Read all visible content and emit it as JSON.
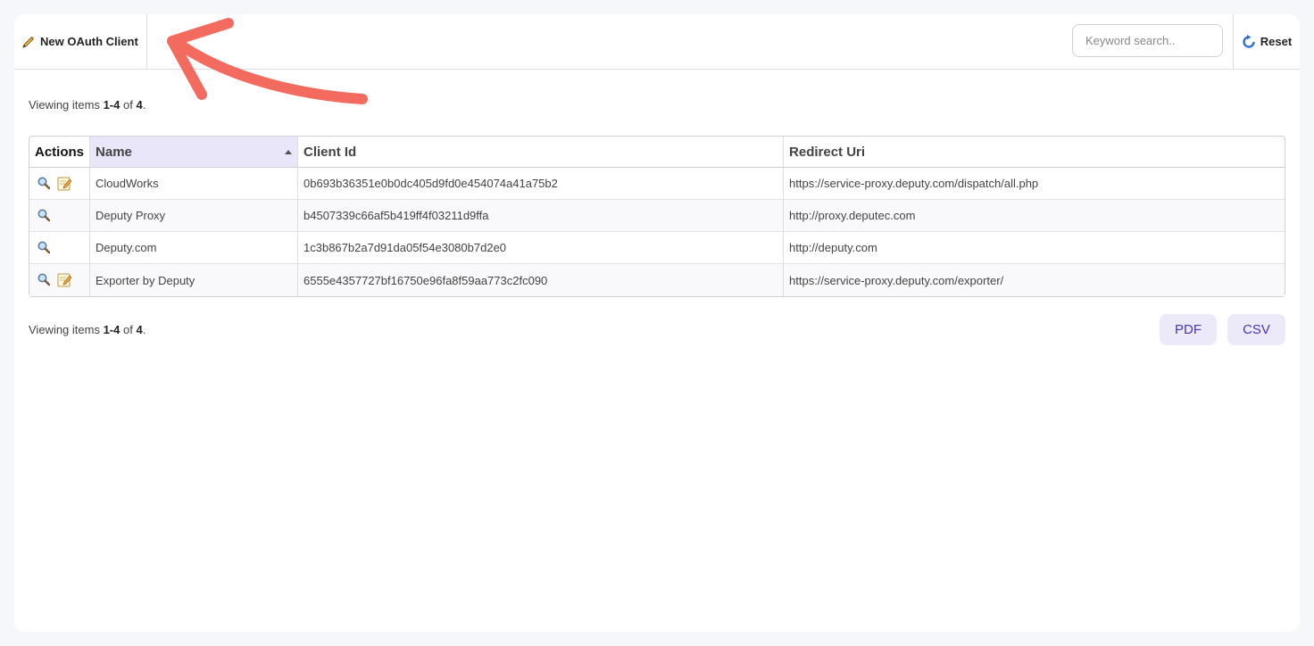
{
  "toolbar": {
    "new_label": "New OAuth Client",
    "search_placeholder": "Keyword search..",
    "reset_label": "Reset"
  },
  "summary": {
    "prefix": "Viewing items ",
    "range": "1-4",
    "middle": " of ",
    "total": "4",
    "suffix": "."
  },
  "table": {
    "headers": [
      "Actions",
      "Name",
      "Client Id",
      "Redirect Uri"
    ],
    "rows": [
      {
        "name": "CloudWorks",
        "client_id": "0b693b36351e0b0dc405d9fd0e454074a41a75b2",
        "redirect_uri": "https://service-proxy.deputy.com/dispatch/all.php",
        "editable": true
      },
      {
        "name": "Deputy Proxy",
        "client_id": "b4507339c66af5b419ff4f03211d9ffa",
        "redirect_uri": "http://proxy.deputec.com",
        "editable": false
      },
      {
        "name": "Deputy.com",
        "client_id": "1c3b867b2a7d91da05f54e3080b7d2e0",
        "redirect_uri": "http://deputy.com",
        "editable": false
      },
      {
        "name": "Exporter by Deputy",
        "client_id": "6555e4357727bf16750e96fa8f59aa773c2fc090",
        "redirect_uri": "https://service-proxy.deputy.com/exporter/",
        "editable": true
      }
    ]
  },
  "export": {
    "pdf_label": "PDF",
    "csv_label": "CSV"
  },
  "colors": {
    "accent": "#4a33b5",
    "sorted_header": "#e8e6f8",
    "annotation_arrow": "#f26b5e"
  },
  "icons": {
    "new": "wand-pencil-icon",
    "reset": "refresh-icon",
    "view": "magnifier-icon",
    "edit": "edit-note-icon"
  }
}
